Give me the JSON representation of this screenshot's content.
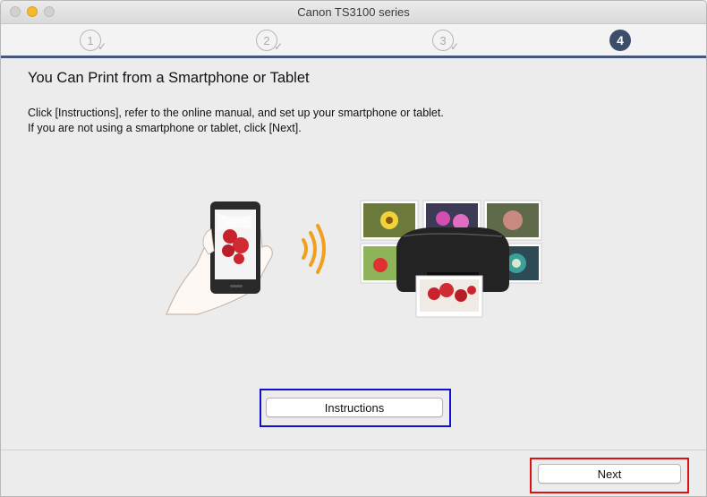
{
  "window": {
    "title": "Canon TS3100 series"
  },
  "steps": [
    {
      "number": "1",
      "state": "done"
    },
    {
      "number": "2",
      "state": "done"
    },
    {
      "number": "3",
      "state": "done"
    },
    {
      "number": "4",
      "state": "active"
    }
  ],
  "page": {
    "title": "You Can Print from a Smartphone or Tablet",
    "line1": "Click [Instructions], refer to the online manual, and set up your smartphone or tablet.",
    "line2": "If you are not using a smartphone or tablet, click [Next]."
  },
  "buttons": {
    "instructions_label": "Instructions",
    "next_label": "Next"
  },
  "colors": {
    "accent": "#3d4e6b",
    "highlight_instructions": "#1010d0",
    "highlight_next": "#e01010",
    "wifi": "#f0a020"
  }
}
